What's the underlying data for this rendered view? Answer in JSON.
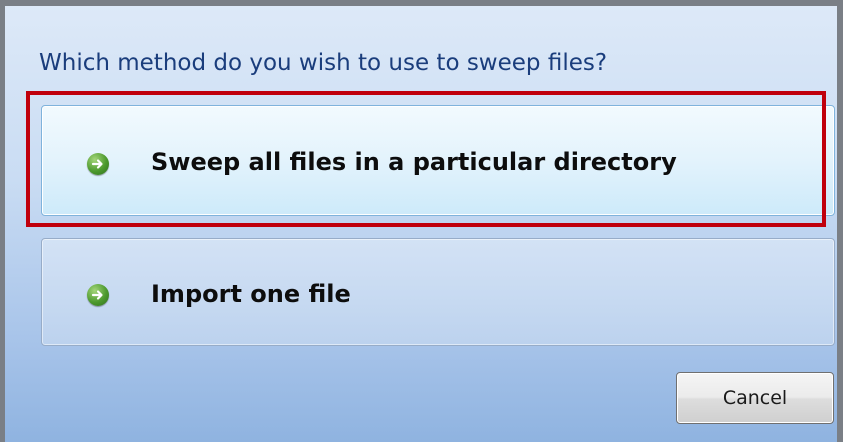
{
  "dialog": {
    "question": "Which method do you wish to use to sweep files?",
    "options": [
      {
        "label": "Sweep all files in a particular directory",
        "icon": "arrow-right-circle-icon",
        "highlighted": true
      },
      {
        "label": "Import one file",
        "icon": "arrow-right-circle-icon",
        "highlighted": false
      }
    ],
    "cancel_label": "Cancel"
  },
  "colors": {
    "question_text": "#1a3d7c",
    "highlight_border": "#c0000c",
    "icon_green": "#4d9a2e"
  }
}
